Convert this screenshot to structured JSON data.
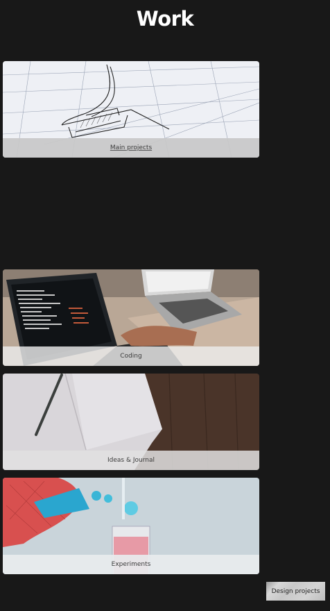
{
  "page": {
    "title": "Work"
  },
  "cards": [
    {
      "label": "Main projects",
      "image": "architectural-drawing"
    },
    {
      "label": "Coding",
      "image": "laptops-with-code"
    },
    {
      "label": "Ideas & Journal",
      "image": "notebook-with-pencil"
    },
    {
      "label": "Experiments",
      "image": "lab-flask-and-beaker"
    }
  ],
  "footer": {
    "design_button_label": "Design projects"
  },
  "colors": {
    "background": "#181818",
    "title": "#ffffff"
  }
}
